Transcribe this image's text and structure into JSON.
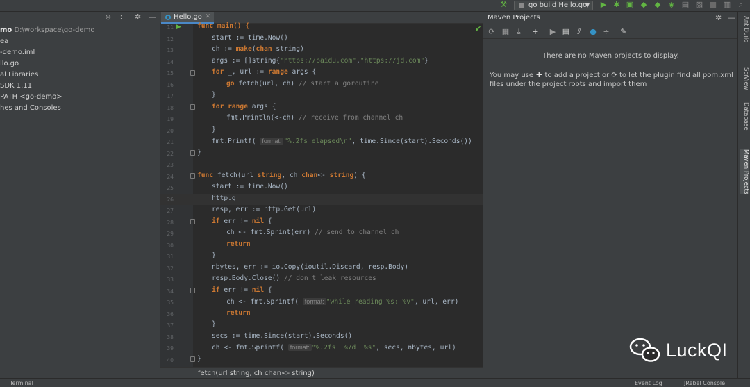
{
  "toolbar": {
    "run_config": "go build Hello.go",
    "icons": [
      "hammer-icon",
      "run-icon",
      "debug-icon",
      "coverage-icon",
      "profile-icon",
      "attach-icon",
      "stop-icon",
      "layout-icon",
      "search-icon"
    ]
  },
  "project": {
    "items": [
      {
        "bold": "mo",
        "path": "D:\\workspace\\go-demo"
      },
      {
        "text": "ea"
      },
      {
        "text": "-demo.iml"
      },
      {
        "text": "llo.go"
      },
      {
        "text": "al Libraries"
      },
      {
        "text": "SDK 1.11"
      },
      {
        "text": "PATH <go-demo>"
      },
      {
        "text": "hes and Consoles"
      }
    ]
  },
  "editor": {
    "tab_label": "Hello.go",
    "line_numbers": [
      "11",
      "12",
      "13",
      "14",
      "15",
      "16",
      "17",
      "18",
      "19",
      "20",
      "21",
      "22",
      "23",
      "24",
      "25",
      "26",
      "27",
      "28",
      "29",
      "30",
      "31",
      "32",
      "33",
      "34",
      "35",
      "36",
      "37",
      "38",
      "39",
      "40"
    ],
    "hint_text": "fetch(url string, ch chan<- string)",
    "inlay": {
      "format": "format:"
    },
    "code": {
      "l11": "func main() {",
      "l12": "start := time.Now()",
      "l13a": "ch := ",
      "l13b": "make",
      "l13c": "(",
      "l13d": "chan",
      "l13e": " string)",
      "l14a": "args := []string{",
      "l14b": "\"https://baidu.com\"",
      "l14c": ",",
      "l14d": "\"https://jd.com\"",
      "l14e": "}",
      "l15a": "for",
      "l15b": " _, url := ",
      "l15c": "range",
      "l15d": " args {",
      "l16a": "go",
      "l16b": " fetch(url, ch) ",
      "l16c": "// start a goroutine",
      "l17": "}",
      "l18a": "for range",
      "l18b": " args {",
      "l19a": "fmt.Println(<-ch) ",
      "l19b": "// receive from channel ch",
      "l20": "}",
      "l21a": "fmt.Printf( ",
      "l21b": "\"%.2fs elapsed\\n\"",
      "l21c": ", time.Since(start).Seconds())",
      "l22": "}",
      "l24a": "func",
      "l24b": " fetch(url ",
      "l24c": "string",
      "l24d": ", ch ",
      "l24e": "chan",
      "l24f": "<- ",
      "l24g": "string",
      "l24h": ") {",
      "l25": "start := time.Now()",
      "l26": "http.g",
      "l27": "resp, err := http.Get(url)",
      "l28a": "if",
      "l28b": " err != ",
      "l28c": "nil",
      "l28d": " {",
      "l29a": "ch <- fmt.Sprint(err) ",
      "l29b": "// send to channel ch",
      "l30": "return",
      "l31": "}",
      "l32": "nbytes, err := io.Copy(ioutil.Discard, resp.Body)",
      "l33a": "resp.Body.Close() ",
      "l33b": "// don't leak resources",
      "l34a": "if",
      "l34b": " err != ",
      "l34c": "nil",
      "l34d": " {",
      "l35a": "ch <- fmt.Sprintf( ",
      "l35b": "\"while reading %s: %v\"",
      "l35c": ", url, err)",
      "l36": "return",
      "l37": "}",
      "l38": "secs := time.Since(start).Seconds()",
      "l39a": "ch <- fmt.Sprintf( ",
      "l39b": "\"%.2fs  %7d  %s\"",
      "l39c": ", secs, nbytes, url)",
      "l40": "}"
    }
  },
  "maven": {
    "title": "Maven Projects",
    "empty_text": "There are no Maven projects to display.",
    "info_a": "You may use",
    "info_b": "to add a project or",
    "info_c": "to let the plugin find all pom.xml files under the project roots and import them"
  },
  "right_tabs": [
    "Ant Build",
    "SciView",
    "Database",
    "Maven Projects"
  ],
  "status": {
    "left": "Terminal",
    "event_log": "Event Log",
    "jrebel": "JRebel Console"
  },
  "watermark": {
    "text": "LuckQI"
  },
  "colors": {
    "keyword": "#cc7832",
    "string": "#6a8759",
    "comment": "#808080",
    "accent": "#4a88c7",
    "run_green": "#62b543"
  }
}
